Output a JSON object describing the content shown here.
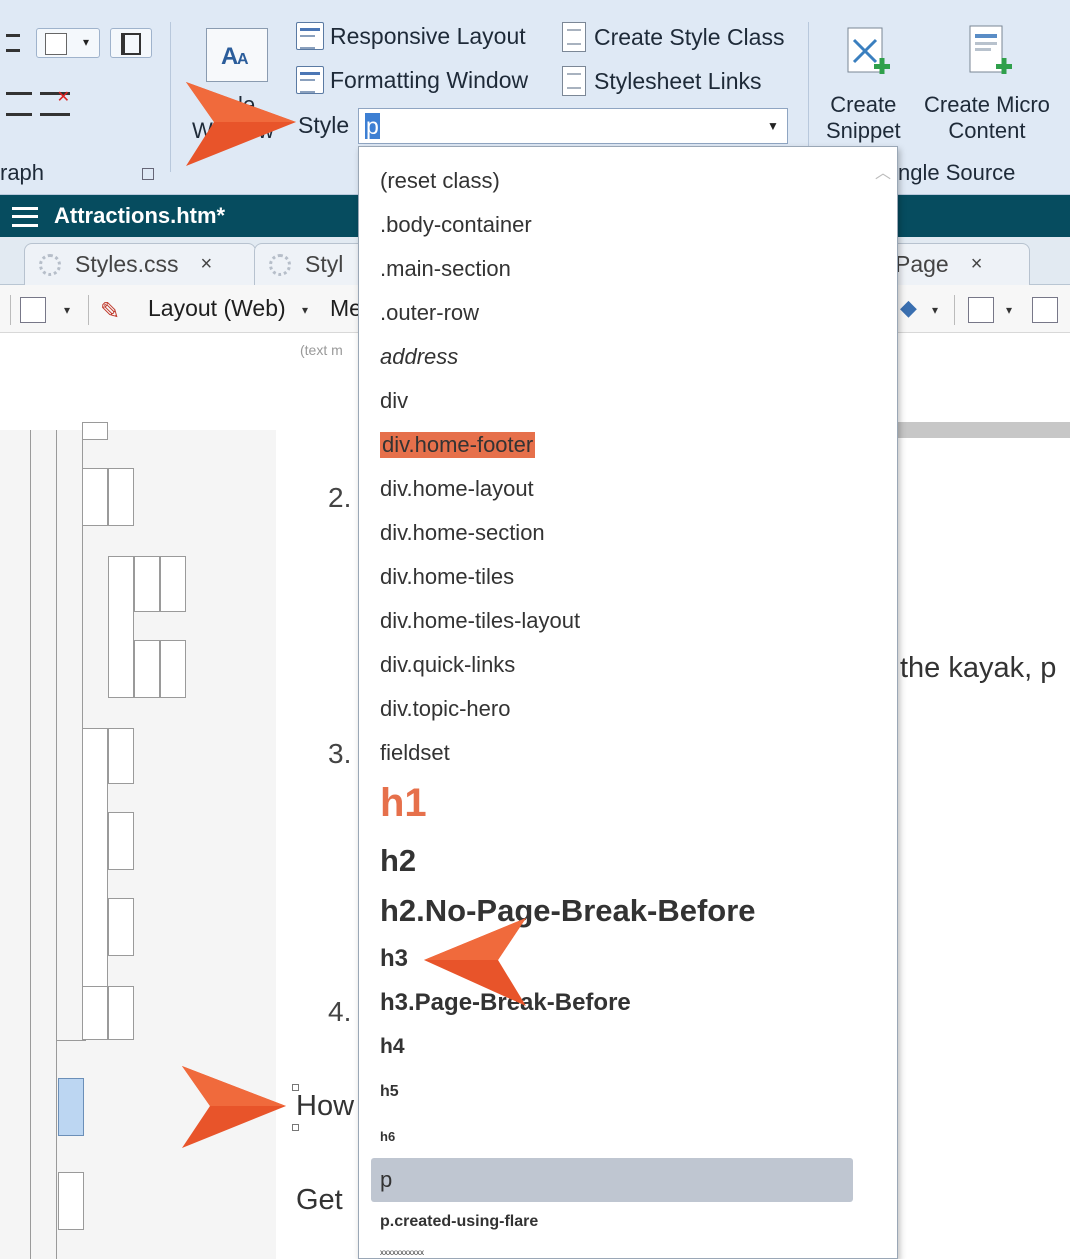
{
  "ribbon": {
    "items": {
      "responsive_layout": "Responsive Layout",
      "formatting_window": "Formatting Window",
      "create_style_class": "Create Style Class",
      "stylesheet_links": "Stylesheet Links",
      "style_label": "Style",
      "style_value": "p",
      "style_window_label_a": "le",
      "style_window_label_b": "W",
      "style_window_label_c": "w"
    },
    "single_source": {
      "create_snippet": [
        "Create",
        "Snippet"
      ],
      "create_micro_content": [
        "Create Micro",
        "Content"
      ],
      "group_label": "ngle Source"
    },
    "paragraph_group_label": "raph"
  },
  "document": {
    "title": "Attractions.htm*",
    "tabs": [
      {
        "label": "Styles.css",
        "close": "×"
      },
      {
        "label": "Styl",
        "close": ""
      },
      {
        "label": "Page",
        "close": "×"
      }
    ]
  },
  "toolbar": {
    "layout_label": "Layout (Web)",
    "me_label": "Me",
    "caret": "▾"
  },
  "editor": {
    "hint": "(text m",
    "numbers": [
      "2.",
      "3.",
      "4."
    ],
    "text_kayak": "the kayak, p",
    "text_how": "How",
    "text_get": "Get"
  },
  "style_dropdown": {
    "items": [
      {
        "label": "(reset class)",
        "kind": "normal"
      },
      {
        "label": ".body-container",
        "kind": "normal"
      },
      {
        "label": ".main-section",
        "kind": "normal"
      },
      {
        "label": ".outer-row",
        "kind": "normal"
      },
      {
        "label": "address",
        "kind": "italic"
      },
      {
        "label": "div",
        "kind": "normal"
      },
      {
        "label": "div.home-footer",
        "kind": "highlight"
      },
      {
        "label": "div.home-layout",
        "kind": "normal"
      },
      {
        "label": "div.home-section",
        "kind": "normal"
      },
      {
        "label": "div.home-tiles",
        "kind": "normal"
      },
      {
        "label": "div.home-tiles-layout",
        "kind": "normal"
      },
      {
        "label": "div.quick-links",
        "kind": "normal"
      },
      {
        "label": "div.topic-hero",
        "kind": "normal"
      },
      {
        "label": "fieldset",
        "kind": "normal"
      },
      {
        "label": "h1",
        "kind": "h1"
      },
      {
        "label": "h2",
        "kind": "h2"
      },
      {
        "label": "h2.No-Page-Break-Before",
        "kind": "h2"
      },
      {
        "label": "h3",
        "kind": "h3"
      },
      {
        "label": "h3.Page-Break-Before",
        "kind": "h3"
      },
      {
        "label": "h4",
        "kind": "h4"
      },
      {
        "label": "h5",
        "kind": "h5"
      },
      {
        "label": "h6",
        "kind": "h6"
      },
      {
        "label": "p",
        "kind": "selected"
      },
      {
        "label": "p.created-using-flare",
        "kind": "small-bold"
      },
      {
        "label": "xxxxxxxxxxx",
        "kind": "tiny"
      }
    ],
    "selected": "p"
  },
  "colors": {
    "accent_orange": "#e6542a",
    "title_bar": "#064c5f",
    "ribbon_bg": "#dfe9f5",
    "h1_color": "#e6704b"
  }
}
